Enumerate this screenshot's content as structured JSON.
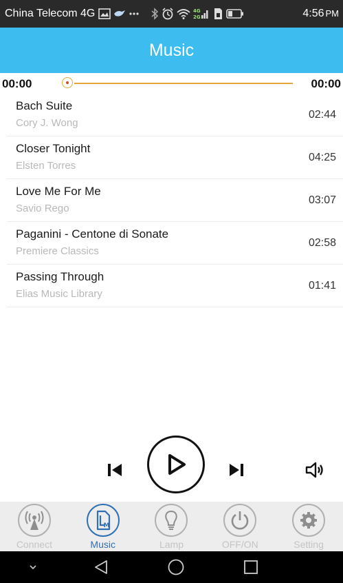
{
  "status_bar": {
    "carrier": "China Telecom 4G",
    "network_label": "4G 2G",
    "time": "4:56",
    "time_suffix": "PM"
  },
  "header": {
    "title": "Music"
  },
  "player": {
    "current_time": "00:00",
    "total_time": "00:00",
    "progress": 0,
    "accent_color": "#e3a63b"
  },
  "songs": [
    {
      "title": "Bach Suite",
      "artist": "Cory J. Wong",
      "duration": "02:44"
    },
    {
      "title": "Closer Tonight",
      "artist": "Elsten Torres",
      "duration": "04:25"
    },
    {
      "title": "Love Me For Me",
      "artist": "Savio Rego",
      "duration": "03:07"
    },
    {
      "title": "Paganini - Centone di Sonate",
      "artist": "Premiere Classics",
      "duration": "02:58"
    },
    {
      "title": "Passing Through",
      "artist": "Elias Music Library",
      "duration": "01:41"
    }
  ],
  "controls": {
    "prev_icon": "skip-previous-icon",
    "play_icon": "play-icon",
    "next_icon": "skip-next-icon",
    "volume_icon": "volume-icon"
  },
  "bottom_nav": {
    "active": "Music",
    "active_color": "#2f6fb3",
    "items": [
      {
        "label": "Connect",
        "icon": "antenna-icon"
      },
      {
        "label": "Music",
        "icon": "music-icon"
      },
      {
        "label": "Lamp",
        "icon": "lightbulb-icon"
      },
      {
        "label": "OFF/ON",
        "icon": "power-icon"
      },
      {
        "label": "Setting",
        "icon": "gear-icon"
      }
    ]
  },
  "colors": {
    "header_bg": "#3cbcef",
    "status_bar_bg": "#2a2a2a",
    "nav_bg": "#ededed"
  }
}
